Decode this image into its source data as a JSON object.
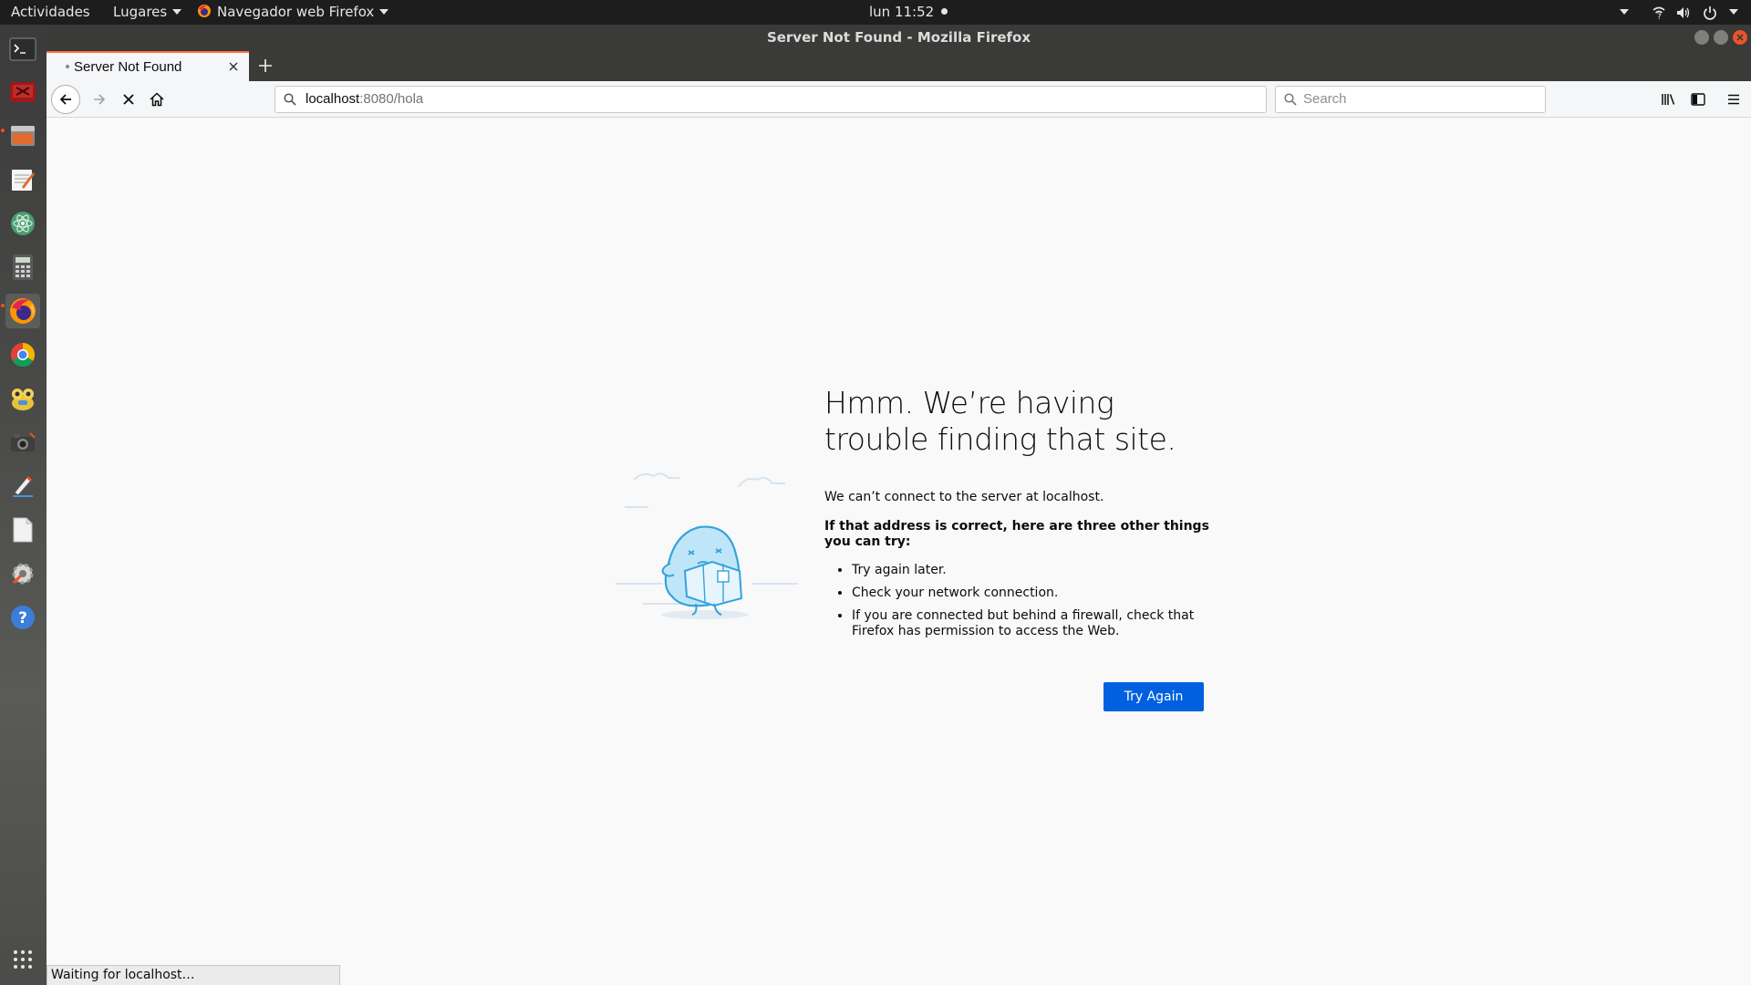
{
  "topbar": {
    "activities": "Actividades",
    "places": "Lugares",
    "app_menu": "Navegador web Firefox",
    "clock": "lun 11:52"
  },
  "window": {
    "title": "Server Not Found - Mozilla Firefox"
  },
  "tabs": [
    {
      "label": "Server Not Found"
    }
  ],
  "navbar": {
    "url_host": "localhost",
    "url_rest": ":8080/hola",
    "search_placeholder": "Search"
  },
  "dock": {
    "items": [
      "terminal-icon",
      "display-icon",
      "files-icon",
      "text-editor-icon",
      "atom-icon",
      "calculator-icon",
      "firefox-icon",
      "chrome-icon",
      "games-icon",
      "screenshot-icon",
      "drawing-icon",
      "document-icon",
      "settings-icon",
      "help-icon",
      "app-grid-icon"
    ]
  },
  "error": {
    "title": "Hmm. We’re having trouble finding that site.",
    "description": "We can’t connect to the server at localhost.",
    "hint": "If that address is correct, here are three other things you can try:",
    "suggestions": [
      "Try again later.",
      "Check your network connection.",
      "If you are connected but behind a firewall, check that Firefox has permission to access the Web."
    ],
    "button_label": "Try Again"
  },
  "status": {
    "text": "Waiting for localhost…"
  },
  "colors": {
    "accent": "#0060df",
    "tab_highlight": "#ff7139",
    "ubuntu_orange": "#e95420"
  }
}
